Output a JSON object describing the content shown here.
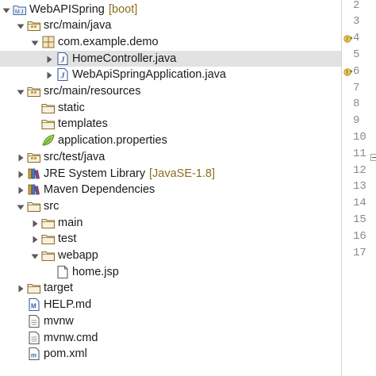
{
  "tree": {
    "items": [
      {
        "label": "WebAPISpring",
        "decoration": "[boot]",
        "icon": "boot-project-icon",
        "toggle": "down",
        "depth": 0
      },
      {
        "label": "src/main/java",
        "icon": "source-folder-icon",
        "toggle": "down",
        "depth": 1
      },
      {
        "label": "com.example.demo",
        "icon": "package-icon",
        "toggle": "down",
        "depth": 2
      },
      {
        "label": "HomeController.java",
        "icon": "java-file-icon",
        "toggle": "right",
        "depth": 3,
        "selected": true
      },
      {
        "label": "WebApiSpringApplication.java",
        "icon": "java-file-icon",
        "toggle": "right",
        "depth": 3
      },
      {
        "label": "src/main/resources",
        "icon": "source-folder-icon",
        "toggle": "down",
        "depth": 1
      },
      {
        "label": "static",
        "icon": "folder-icon",
        "toggle": "none",
        "depth": 2
      },
      {
        "label": "templates",
        "icon": "folder-icon",
        "toggle": "none",
        "depth": 2
      },
      {
        "label": "application.properties",
        "icon": "properties-file-icon",
        "toggle": "none",
        "depth": 2
      },
      {
        "label": "src/test/java",
        "icon": "source-folder-icon",
        "toggle": "right",
        "depth": 1
      },
      {
        "label": "JRE System Library",
        "decoration": "[JavaSE-1.8]",
        "icon": "library-icon",
        "toggle": "right",
        "depth": 1
      },
      {
        "label": "Maven Dependencies",
        "icon": "library-icon",
        "toggle": "right",
        "depth": 1
      },
      {
        "label": "src",
        "icon": "folder-icon",
        "toggle": "down",
        "depth": 1
      },
      {
        "label": "main",
        "icon": "folder-icon",
        "toggle": "right",
        "depth": 2
      },
      {
        "label": "test",
        "icon": "folder-icon",
        "toggle": "right",
        "depth": 2
      },
      {
        "label": "webapp",
        "icon": "folder-icon",
        "toggle": "down",
        "depth": 2
      },
      {
        "label": "home.jsp",
        "icon": "jsp-file-icon",
        "toggle": "none",
        "depth": 3
      },
      {
        "label": "target",
        "icon": "folder-icon",
        "toggle": "right",
        "depth": 1
      },
      {
        "label": "HELP.md",
        "icon": "markdown-file-icon",
        "toggle": "none",
        "depth": 1
      },
      {
        "label": "mvnw",
        "icon": "text-file-icon",
        "toggle": "none",
        "depth": 1
      },
      {
        "label": "mvnw.cmd",
        "icon": "text-file-icon",
        "toggle": "none",
        "depth": 1
      },
      {
        "label": "pom.xml",
        "icon": "xml-file-icon",
        "toggle": "none",
        "depth": 1
      }
    ]
  },
  "editor_gutter": {
    "lines": [
      "2",
      "3",
      "4",
      "5",
      "6",
      "7",
      "8",
      "9",
      "10",
      "11",
      "12",
      "13",
      "14",
      "15",
      "16",
      "17"
    ],
    "markers": [
      {
        "line": "4",
        "icon": "warning-override-icon"
      },
      {
        "line": "6",
        "icon": "warning-override-icon"
      },
      {
        "line": "11",
        "icon": "fold-collapse-icon"
      }
    ]
  },
  "colors": {
    "selection": "#e2e2e2",
    "decoration": "#8b6d1c",
    "line_number": "#8a8a8a"
  }
}
